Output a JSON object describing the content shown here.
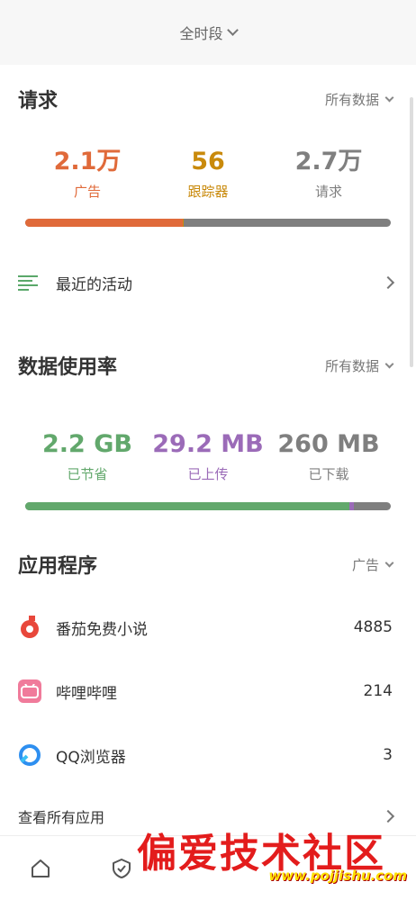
{
  "header": {
    "period": "全时段"
  },
  "requests": {
    "title": "请求",
    "filter": "所有数据",
    "stats": [
      {
        "value": "2.1万",
        "label": "广告",
        "color": "#e06a3a"
      },
      {
        "value": "56",
        "label": "跟踪器",
        "color": "#c98a0c"
      },
      {
        "value": "2.7万",
        "label": "请求",
        "color": "#7f7f7f"
      }
    ],
    "bar": {
      "ads_pct": 43,
      "trackers_pct": 0.2,
      "requests_color": "#7f7f7f"
    },
    "recent_activity": "最近的活动"
  },
  "data_usage": {
    "title": "数据使用率",
    "filter": "所有数据",
    "stats": [
      {
        "value": "2.2 GB",
        "label": "已节省",
        "color": "#62a86c"
      },
      {
        "value": "29.2 MB",
        "label": "已上传",
        "color": "#9b6bb8"
      },
      {
        "value": "260 MB",
        "label": "已下载",
        "color": "#7f7f7f"
      }
    ],
    "bar": {
      "saved_pct": 88.7,
      "uploaded_pct": 1.2
    }
  },
  "apps": {
    "title": "应用程序",
    "filter": "广告",
    "items": [
      {
        "name": "番茄免费小说",
        "count": "4885",
        "icon": "tomato-novel-icon"
      },
      {
        "name": "哔哩哔哩",
        "count": "214",
        "icon": "bilibili-icon"
      },
      {
        "name": "QQ浏览器",
        "count": "3",
        "icon": "qq-browser-icon"
      }
    ],
    "view_all": "查看所有应用"
  },
  "nav": {
    "items": [
      "home-icon",
      "shield-icon"
    ]
  },
  "watermark": {
    "text": "偏爱技术社区",
    "url": "www.pojjishu.com"
  }
}
